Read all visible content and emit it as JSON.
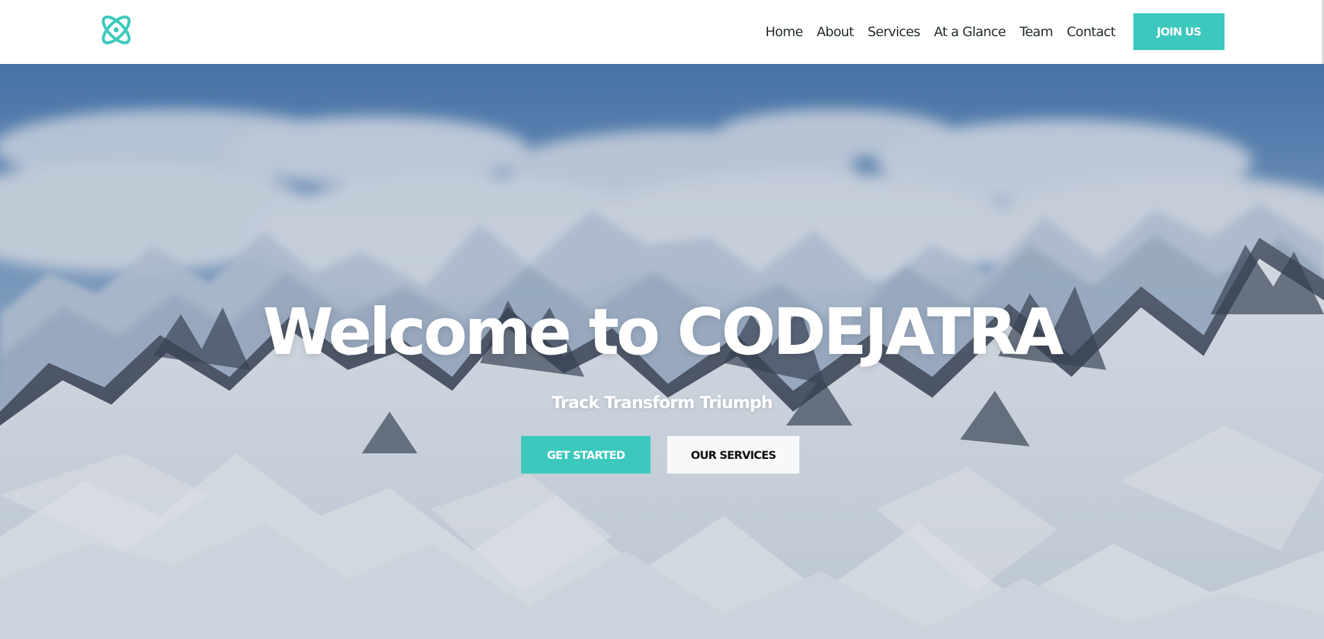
{
  "header": {
    "logo_icon": "atom-orbit-logo-icon",
    "nav": [
      {
        "label": "Home"
      },
      {
        "label": "About"
      },
      {
        "label": "Services"
      },
      {
        "label": "At a Glance"
      },
      {
        "label": "Team"
      },
      {
        "label": "Contact"
      }
    ],
    "join_label": "JOIN US"
  },
  "hero": {
    "title": "Welcome to CODEJATRA",
    "subtitle": "Track Transform Triumph",
    "primary_button": "GET STARTED",
    "secondary_button": "OUR SERVICES"
  },
  "colors": {
    "accent": "#3cc8bd",
    "nav_text": "#1f2a2e",
    "hero_text": "#ffffff"
  }
}
